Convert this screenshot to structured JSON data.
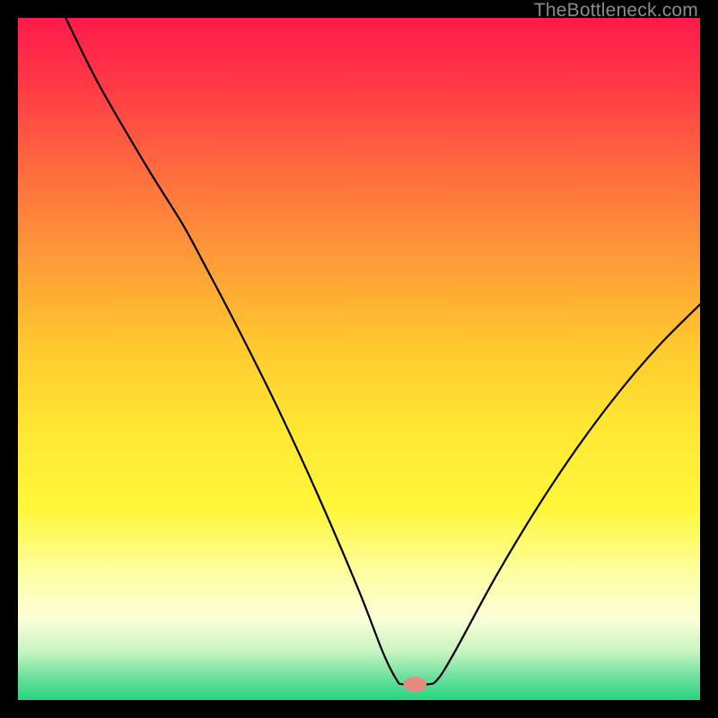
{
  "watermark": {
    "text": "TheBottleneck.com"
  },
  "chart_data": {
    "type": "line",
    "title": "",
    "xlabel": "",
    "ylabel": "",
    "xlim": [
      0,
      100
    ],
    "ylim": [
      0,
      100
    ],
    "grid": false,
    "legend": false,
    "background_gradient": {
      "stops": [
        {
          "offset": 0.0,
          "color": "#ff1a4b"
        },
        {
          "offset": 0.1,
          "color": "#ff3a45"
        },
        {
          "offset": 0.22,
          "color": "#ff6a3f"
        },
        {
          "offset": 0.35,
          "color": "#ff9a38"
        },
        {
          "offset": 0.48,
          "color": "#ffc82f"
        },
        {
          "offset": 0.6,
          "color": "#ffe732"
        },
        {
          "offset": 0.72,
          "color": "#fff73a"
        },
        {
          "offset": 0.82,
          "color": "#ffffa8"
        },
        {
          "offset": 0.88,
          "color": "#fbffd8"
        },
        {
          "offset": 0.93,
          "color": "#c6f5c0"
        },
        {
          "offset": 0.965,
          "color": "#6fe0a0"
        },
        {
          "offset": 1.0,
          "color": "#27d580"
        }
      ]
    },
    "curve": {
      "description": "V-shaped bottleneck curve; minimum near x≈58",
      "points": [
        {
          "x": 7.0,
          "y": 100.0
        },
        {
          "x": 12.0,
          "y": 90.0
        },
        {
          "x": 19.0,
          "y": 78.0
        },
        {
          "x": 24.0,
          "y": 70.0
        },
        {
          "x": 27.0,
          "y": 64.5
        },
        {
          "x": 32.0,
          "y": 55.0
        },
        {
          "x": 38.0,
          "y": 43.0
        },
        {
          "x": 44.0,
          "y": 30.0
        },
        {
          "x": 50.0,
          "y": 16.0
        },
        {
          "x": 53.5,
          "y": 7.0
        },
        {
          "x": 55.5,
          "y": 3.0
        },
        {
          "x": 56.5,
          "y": 2.3
        },
        {
          "x": 60.0,
          "y": 2.3
        },
        {
          "x": 61.5,
          "y": 3.0
        },
        {
          "x": 64.0,
          "y": 7.0
        },
        {
          "x": 70.0,
          "y": 18.0
        },
        {
          "x": 76.0,
          "y": 28.0
        },
        {
          "x": 82.0,
          "y": 37.0
        },
        {
          "x": 88.0,
          "y": 45.0
        },
        {
          "x": 94.0,
          "y": 52.0
        },
        {
          "x": 100.0,
          "y": 58.0
        }
      ]
    },
    "marker": {
      "x": 58.2,
      "y": 2.3,
      "rx": 1.7,
      "ry": 1.1,
      "color": "#e58a7e"
    }
  }
}
